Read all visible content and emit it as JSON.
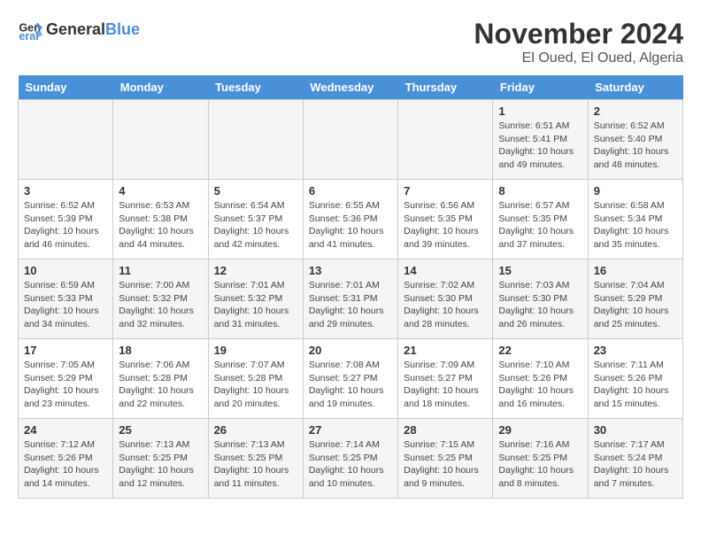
{
  "header": {
    "logo_general": "General",
    "logo_blue": "Blue",
    "month": "November 2024",
    "location": "El Oued, El Oued, Algeria"
  },
  "days_of_week": [
    "Sunday",
    "Monday",
    "Tuesday",
    "Wednesday",
    "Thursday",
    "Friday",
    "Saturday"
  ],
  "weeks": [
    [
      {
        "day": "",
        "info": ""
      },
      {
        "day": "",
        "info": ""
      },
      {
        "day": "",
        "info": ""
      },
      {
        "day": "",
        "info": ""
      },
      {
        "day": "",
        "info": ""
      },
      {
        "day": "1",
        "info": "Sunrise: 6:51 AM\nSunset: 5:41 PM\nDaylight: 10 hours\nand 49 minutes."
      },
      {
        "day": "2",
        "info": "Sunrise: 6:52 AM\nSunset: 5:40 PM\nDaylight: 10 hours\nand 48 minutes."
      }
    ],
    [
      {
        "day": "3",
        "info": "Sunrise: 6:52 AM\nSunset: 5:39 PM\nDaylight: 10 hours\nand 46 minutes."
      },
      {
        "day": "4",
        "info": "Sunrise: 6:53 AM\nSunset: 5:38 PM\nDaylight: 10 hours\nand 44 minutes."
      },
      {
        "day": "5",
        "info": "Sunrise: 6:54 AM\nSunset: 5:37 PM\nDaylight: 10 hours\nand 42 minutes."
      },
      {
        "day": "6",
        "info": "Sunrise: 6:55 AM\nSunset: 5:36 PM\nDaylight: 10 hours\nand 41 minutes."
      },
      {
        "day": "7",
        "info": "Sunrise: 6:56 AM\nSunset: 5:35 PM\nDaylight: 10 hours\nand 39 minutes."
      },
      {
        "day": "8",
        "info": "Sunrise: 6:57 AM\nSunset: 5:35 PM\nDaylight: 10 hours\nand 37 minutes."
      },
      {
        "day": "9",
        "info": "Sunrise: 6:58 AM\nSunset: 5:34 PM\nDaylight: 10 hours\nand 35 minutes."
      }
    ],
    [
      {
        "day": "10",
        "info": "Sunrise: 6:59 AM\nSunset: 5:33 PM\nDaylight: 10 hours\nand 34 minutes."
      },
      {
        "day": "11",
        "info": "Sunrise: 7:00 AM\nSunset: 5:32 PM\nDaylight: 10 hours\nand 32 minutes."
      },
      {
        "day": "12",
        "info": "Sunrise: 7:01 AM\nSunset: 5:32 PM\nDaylight: 10 hours\nand 31 minutes."
      },
      {
        "day": "13",
        "info": "Sunrise: 7:01 AM\nSunset: 5:31 PM\nDaylight: 10 hours\nand 29 minutes."
      },
      {
        "day": "14",
        "info": "Sunrise: 7:02 AM\nSunset: 5:30 PM\nDaylight: 10 hours\nand 28 minutes."
      },
      {
        "day": "15",
        "info": "Sunrise: 7:03 AM\nSunset: 5:30 PM\nDaylight: 10 hours\nand 26 minutes."
      },
      {
        "day": "16",
        "info": "Sunrise: 7:04 AM\nSunset: 5:29 PM\nDaylight: 10 hours\nand 25 minutes."
      }
    ],
    [
      {
        "day": "17",
        "info": "Sunrise: 7:05 AM\nSunset: 5:29 PM\nDaylight: 10 hours\nand 23 minutes."
      },
      {
        "day": "18",
        "info": "Sunrise: 7:06 AM\nSunset: 5:28 PM\nDaylight: 10 hours\nand 22 minutes."
      },
      {
        "day": "19",
        "info": "Sunrise: 7:07 AM\nSunset: 5:28 PM\nDaylight: 10 hours\nand 20 minutes."
      },
      {
        "day": "20",
        "info": "Sunrise: 7:08 AM\nSunset: 5:27 PM\nDaylight: 10 hours\nand 19 minutes."
      },
      {
        "day": "21",
        "info": "Sunrise: 7:09 AM\nSunset: 5:27 PM\nDaylight: 10 hours\nand 18 minutes."
      },
      {
        "day": "22",
        "info": "Sunrise: 7:10 AM\nSunset: 5:26 PM\nDaylight: 10 hours\nand 16 minutes."
      },
      {
        "day": "23",
        "info": "Sunrise: 7:11 AM\nSunset: 5:26 PM\nDaylight: 10 hours\nand 15 minutes."
      }
    ],
    [
      {
        "day": "24",
        "info": "Sunrise: 7:12 AM\nSunset: 5:26 PM\nDaylight: 10 hours\nand 14 minutes."
      },
      {
        "day": "25",
        "info": "Sunrise: 7:13 AM\nSunset: 5:25 PM\nDaylight: 10 hours\nand 12 minutes."
      },
      {
        "day": "26",
        "info": "Sunrise: 7:13 AM\nSunset: 5:25 PM\nDaylight: 10 hours\nand 11 minutes."
      },
      {
        "day": "27",
        "info": "Sunrise: 7:14 AM\nSunset: 5:25 PM\nDaylight: 10 hours\nand 10 minutes."
      },
      {
        "day": "28",
        "info": "Sunrise: 7:15 AM\nSunset: 5:25 PM\nDaylight: 10 hours\nand 9 minutes."
      },
      {
        "day": "29",
        "info": "Sunrise: 7:16 AM\nSunset: 5:25 PM\nDaylight: 10 hours\nand 8 minutes."
      },
      {
        "day": "30",
        "info": "Sunrise: 7:17 AM\nSunset: 5:24 PM\nDaylight: 10 hours\nand 7 minutes."
      }
    ]
  ]
}
